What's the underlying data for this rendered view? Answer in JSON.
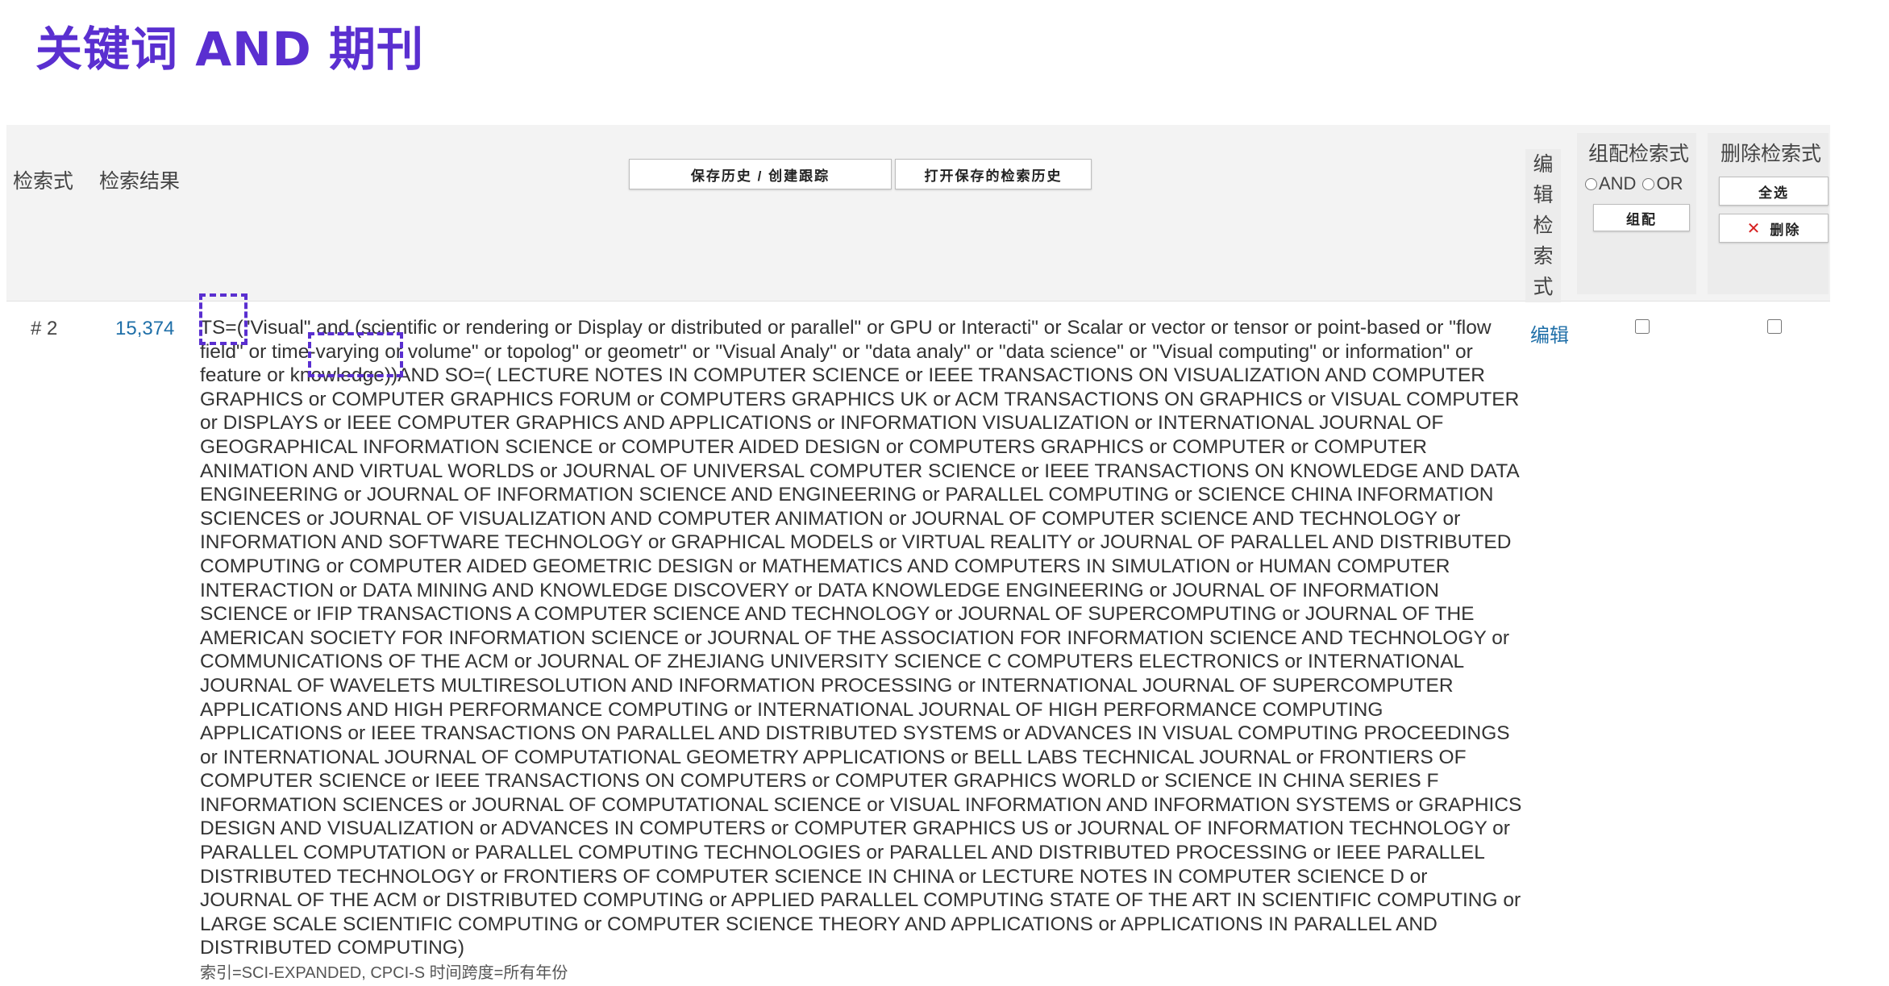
{
  "slide": {
    "title": "关键词 AND 期刊"
  },
  "header": {
    "col_query": "检索式",
    "col_results": "检索结果",
    "save_button": "保存历史 / 创建跟踪",
    "open_button": "打开保存的检索历史",
    "edit_col": [
      "编",
      "辑",
      "检",
      "索",
      "式"
    ],
    "combine": {
      "title": "组配检索式",
      "and_label": "AND",
      "or_label": "OR",
      "button": "组配"
    },
    "delete": {
      "title": "删除检索式",
      "select_all": "全选",
      "delete_button": "删除"
    }
  },
  "row": {
    "number": "# 2",
    "count": "15,374",
    "query_ts_label": "TS=",
    "query_ts_body": "(\"Visual\" and (scientific or rendering or Display or distributed or parallel\" or GPU or Interacti\" or Scalar or vector or tensor or point-based or \"flow field\" or time-varying or volume\" or topolog\" or geometr\" or \"Visual Analy\" or \"data analy\" or \"data science\" or \"Visual computing\" or information\" or feature or knowledge))",
    "query_so_label": "AND SO=",
    "query_so_body": "( LECTURE NOTES IN COMPUTER SCIENCE or IEEE TRANSACTIONS ON VISUALIZATION AND COMPUTER GRAPHICS or COMPUTER GRAPHICS FORUM or COMPUTERS GRAPHICS UK or ACM TRANSACTIONS ON GRAPHICS or VISUAL COMPUTER or DISPLAYS or IEEE COMPUTER GRAPHICS AND APPLICATIONS or INFORMATION VISUALIZATION or INTERNATIONAL JOURNAL OF GEOGRAPHICAL INFORMATION SCIENCE or COMPUTER AIDED DESIGN or COMPUTERS GRAPHICS or COMPUTER or COMPUTER ANIMATION AND VIRTUAL WORLDS or JOURNAL OF UNIVERSAL COMPUTER SCIENCE or IEEE TRANSACTIONS ON KNOWLEDGE AND DATA ENGINEERING or JOURNAL OF INFORMATION SCIENCE AND ENGINEERING or PARALLEL COMPUTING or SCIENCE CHINA INFORMATION SCIENCES or JOURNAL OF VISUALIZATION AND COMPUTER ANIMATION or JOURNAL OF COMPUTER SCIENCE AND TECHNOLOGY or INFORMATION AND SOFTWARE TECHNOLOGY or GRAPHICAL MODELS or VIRTUAL REALITY or JOURNAL OF PARALLEL AND DISTRIBUTED COMPUTING or COMPUTER AIDED GEOMETRIC DESIGN or MATHEMATICS AND COMPUTERS IN SIMULATION or HUMAN COMPUTER INTERACTION or DATA MINING AND KNOWLEDGE DISCOVERY or DATA KNOWLEDGE ENGINEERING or JOURNAL OF INFORMATION SCIENCE or IFIP TRANSACTIONS A COMPUTER SCIENCE AND TECHNOLOGY or JOURNAL OF SUPERCOMPUTING or JOURNAL OF THE AMERICAN SOCIETY FOR INFORMATION SCIENCE or JOURNAL OF THE ASSOCIATION FOR INFORMATION SCIENCE AND TECHNOLOGY or COMMUNICATIONS OF THE ACM or JOURNAL OF ZHEJIANG UNIVERSITY SCIENCE C COMPUTERS ELECTRONICS or INTERNATIONAL JOURNAL OF WAVELETS MULTIRESOLUTION AND INFORMATION PROCESSING or INTERNATIONAL JOURNAL OF SUPERCOMPUTER APPLICATIONS AND HIGH PERFORMANCE COMPUTING or INTERNATIONAL JOURNAL OF HIGH PERFORMANCE COMPUTING APPLICATIONS or IEEE TRANSACTIONS ON PARALLEL AND DISTRIBUTED SYSTEMS or ADVANCES IN VISUAL COMPUTING PROCEEDINGS or INTERNATIONAL JOURNAL OF COMPUTATIONAL GEOMETRY APPLICATIONS or BELL LABS TECHNICAL JOURNAL or FRONTIERS OF COMPUTER SCIENCE or IEEE TRANSACTIONS ON COMPUTERS or COMPUTER GRAPHICS WORLD or SCIENCE IN CHINA SERIES F INFORMATION SCIENCES or JOURNAL OF COMPUTATIONAL SCIENCE or VISUAL INFORMATION AND INFORMATION SYSTEMS or GRAPHICS DESIGN AND VISUALIZATION or ADVANCES IN COMPUTERS or COMPUTER GRAPHICS US or JOURNAL OF INFORMATION TECHNOLOGY or PARALLEL COMPUTATION or PARALLEL COMPUTING TECHNOLOGIES or PARALLEL AND DISTRIBUTED PROCESSING or IEEE PARALLEL DISTRIBUTED TECHNOLOGY or FRONTIERS OF COMPUTER SCIENCE IN CHINA or LECTURE NOTES IN COMPUTER SCIENCE D or JOURNAL OF THE ACM or DISTRIBUTED COMPUTING or APPLIED PARALLEL COMPUTING STATE OF THE ART IN SCIENTIFIC COMPUTING or LARGE SCALE SCIENTIFIC COMPUTING or COMPUTER SCIENCE THEORY AND APPLICATIONS or APPLICATIONS IN PARALLEL AND DISTRIBUTED COMPUTING)",
    "meta": "索引=SCI-EXPANDED, CPCI-S 时间跨度=所有年份",
    "edit_link": "编辑"
  },
  "colors": {
    "title": "#5a2fd0",
    "link": "#1f6fa8",
    "highlight": "#5a2fd0"
  }
}
